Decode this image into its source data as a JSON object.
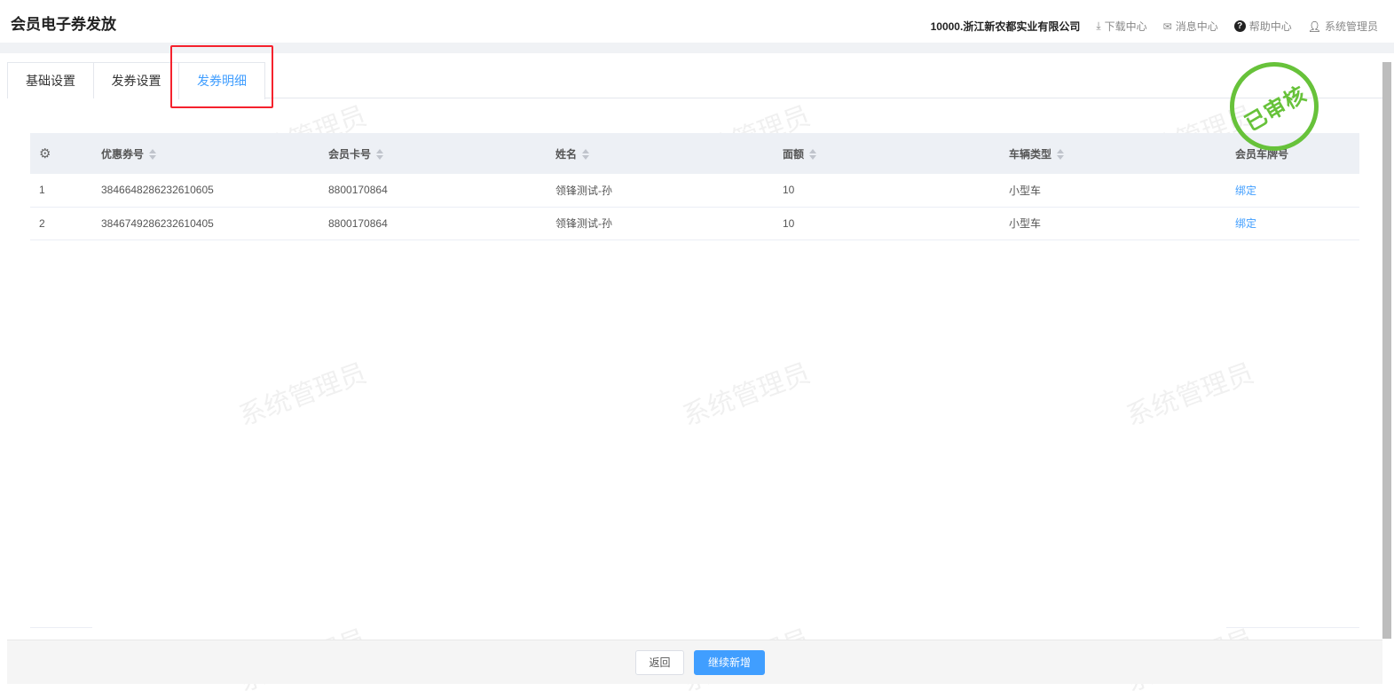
{
  "header": {
    "title": "会员电子券发放",
    "company": "10000.浙江新农都实业有限公司",
    "download": "下载中心",
    "messages": "消息中心",
    "help": "帮助中心",
    "user": "系统管理员"
  },
  "tabs": [
    {
      "label": "基础设置"
    },
    {
      "label": "发券设置"
    },
    {
      "label": "发券明细",
      "active": true
    }
  ],
  "stamp": "已审核",
  "watermark": "系统管理员",
  "table": {
    "columns": [
      "优惠券号",
      "会员卡号",
      "姓名",
      "面额",
      "车辆类型",
      "会员车牌号"
    ],
    "rows": [
      {
        "index": "1",
        "coupon": "3846648286232610605",
        "card": "8800170864",
        "name": "领锋测试-孙",
        "amount": "10",
        "vehicle": "小型车",
        "action": "绑定"
      },
      {
        "index": "2",
        "coupon": "3846749286232610405",
        "card": "8800170864",
        "name": "领锋测试-孙",
        "amount": "10",
        "vehicle": "小型车",
        "action": "绑定"
      }
    ]
  },
  "footer": {
    "back": "返回",
    "continue": "继续新增"
  },
  "colors": {
    "accent": "#409eff",
    "stamp": "#67c23a",
    "highlight": "#f5222d"
  }
}
